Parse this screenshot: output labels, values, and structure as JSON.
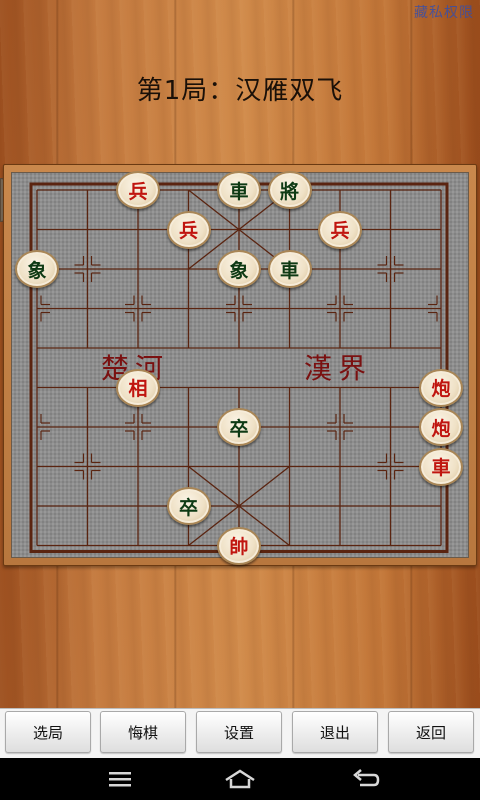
{
  "header": {
    "top_link": "藏私权限",
    "title": "第1局：汉雁双飞"
  },
  "board": {
    "river_left": "楚河",
    "river_right": "漢界",
    "pieces": [
      {
        "label": "兵",
        "side": "red",
        "file": 2,
        "rank": 0
      },
      {
        "label": "車",
        "side": "black",
        "file": 4,
        "rank": 0
      },
      {
        "label": "將",
        "side": "black",
        "file": 5,
        "rank": 0
      },
      {
        "label": "兵",
        "side": "red",
        "file": 3,
        "rank": 1
      },
      {
        "label": "兵",
        "side": "red",
        "file": 6,
        "rank": 1
      },
      {
        "label": "象",
        "side": "black",
        "file": 0,
        "rank": 2
      },
      {
        "label": "象",
        "side": "black",
        "file": 4,
        "rank": 2
      },
      {
        "label": "車",
        "side": "black",
        "file": 5,
        "rank": 2
      },
      {
        "label": "相",
        "side": "red",
        "file": 2,
        "rank": 5
      },
      {
        "label": "炮",
        "side": "red",
        "file": 8,
        "rank": 5
      },
      {
        "label": "卒",
        "side": "black",
        "file": 4,
        "rank": 6
      },
      {
        "label": "炮",
        "side": "red",
        "file": 8,
        "rank": 6
      },
      {
        "label": "車",
        "side": "red",
        "file": 8,
        "rank": 7
      },
      {
        "label": "卒",
        "side": "black",
        "file": 3,
        "rank": 8
      },
      {
        "label": "帥",
        "side": "red",
        "file": 4,
        "rank": 9
      }
    ]
  },
  "toolbar": {
    "select_label": "选局",
    "undo_label": "悔棋",
    "settings_label": "设置",
    "quit_label": "退出",
    "back_label": "返回"
  },
  "colors": {
    "red_piece": "#c0150f",
    "black_piece": "#0e3a14",
    "grid_line": "#5a2410"
  }
}
